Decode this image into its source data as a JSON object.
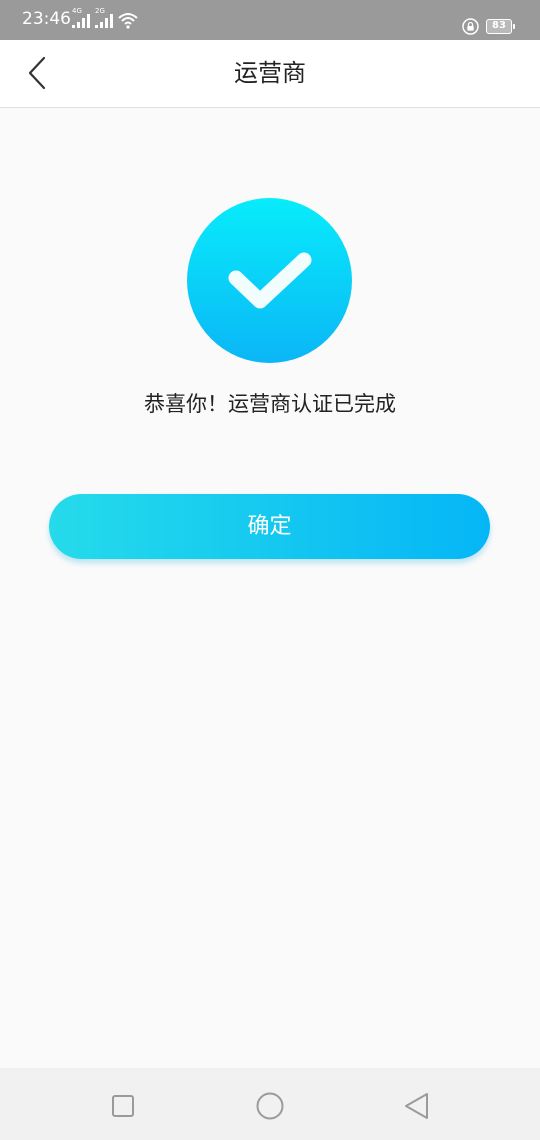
{
  "status_bar": {
    "time": "23:46",
    "signal1_tag": "4G",
    "signal2_tag": "2G",
    "battery_level": "83",
    "icons": [
      "signal-icon",
      "signal-icon",
      "wifi-icon",
      "lock-icon",
      "battery-icon"
    ]
  },
  "header": {
    "title": "运营商",
    "back_icon": "chevron-left-icon"
  },
  "main": {
    "success_icon": "check-circle-icon",
    "message": "恭喜你！运营商认证已完成",
    "confirm_label": "确定"
  },
  "system_nav": {
    "icons": [
      "square-recent-icon",
      "circle-home-icon",
      "triangle-back-icon"
    ]
  },
  "colors": {
    "accent_start": "#25dbea",
    "accent_end": "#05b6f6",
    "status_bar": "#9a9a9a"
  }
}
